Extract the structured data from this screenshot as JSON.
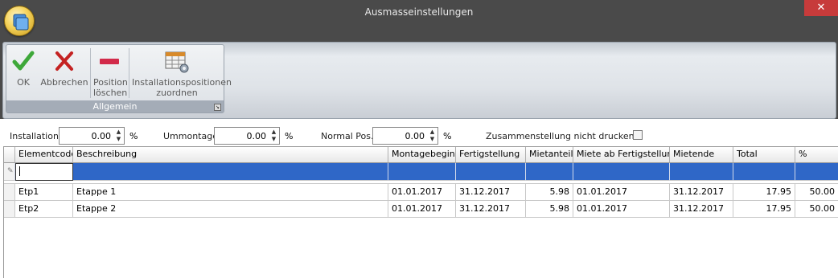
{
  "window": {
    "title": "Ausmasseinstellungen",
    "close_glyph": "✕"
  },
  "ribbon": {
    "group_label": "Allgemein",
    "buttons": {
      "ok": "OK",
      "cancel": "Abbrechen",
      "delete_line1": "Position",
      "delete_line2": "löschen",
      "assign_line1": "Installationspositionen",
      "assign_line2": "zuordnen"
    },
    "icons": [
      "checkmark-icon",
      "x-cross-icon",
      "minus-bar-icon",
      "table-settings-icon"
    ]
  },
  "form": {
    "installation_label": "Installation:",
    "installation_value": "0.00",
    "ummontage_label": "Ummontage:",
    "ummontage_value": "0.00",
    "normal_label": "Normal Pos.:",
    "normal_value": "0.00",
    "percent": "%",
    "summary_label": "Zusammenstellung nicht drucken",
    "summary_checked": false
  },
  "grid": {
    "columns": [
      "Elementcode",
      "Beschreibung",
      "Montagebeginn",
      "Fertigstellung",
      "Mietanteil",
      "Miete ab Fertigstellung",
      "Mietende",
      "Total",
      "%"
    ],
    "rows": [
      [
        "Etp1",
        "Etappe 1",
        "01.01.2017",
        "31.12.2017",
        "5.98",
        "01.01.2017",
        "31.12.2017",
        "17.95",
        "50.00"
      ],
      [
        "Etp2",
        "Etappe 2",
        "01.01.2017",
        "31.12.2017",
        "5.98",
        "01.01.2017",
        "31.12.2017",
        "17.95",
        "50.00"
      ]
    ]
  },
  "colors": {
    "title_bar": "#4a4a4a",
    "selection": "#2f67c7",
    "close": "#c73b3b"
  }
}
